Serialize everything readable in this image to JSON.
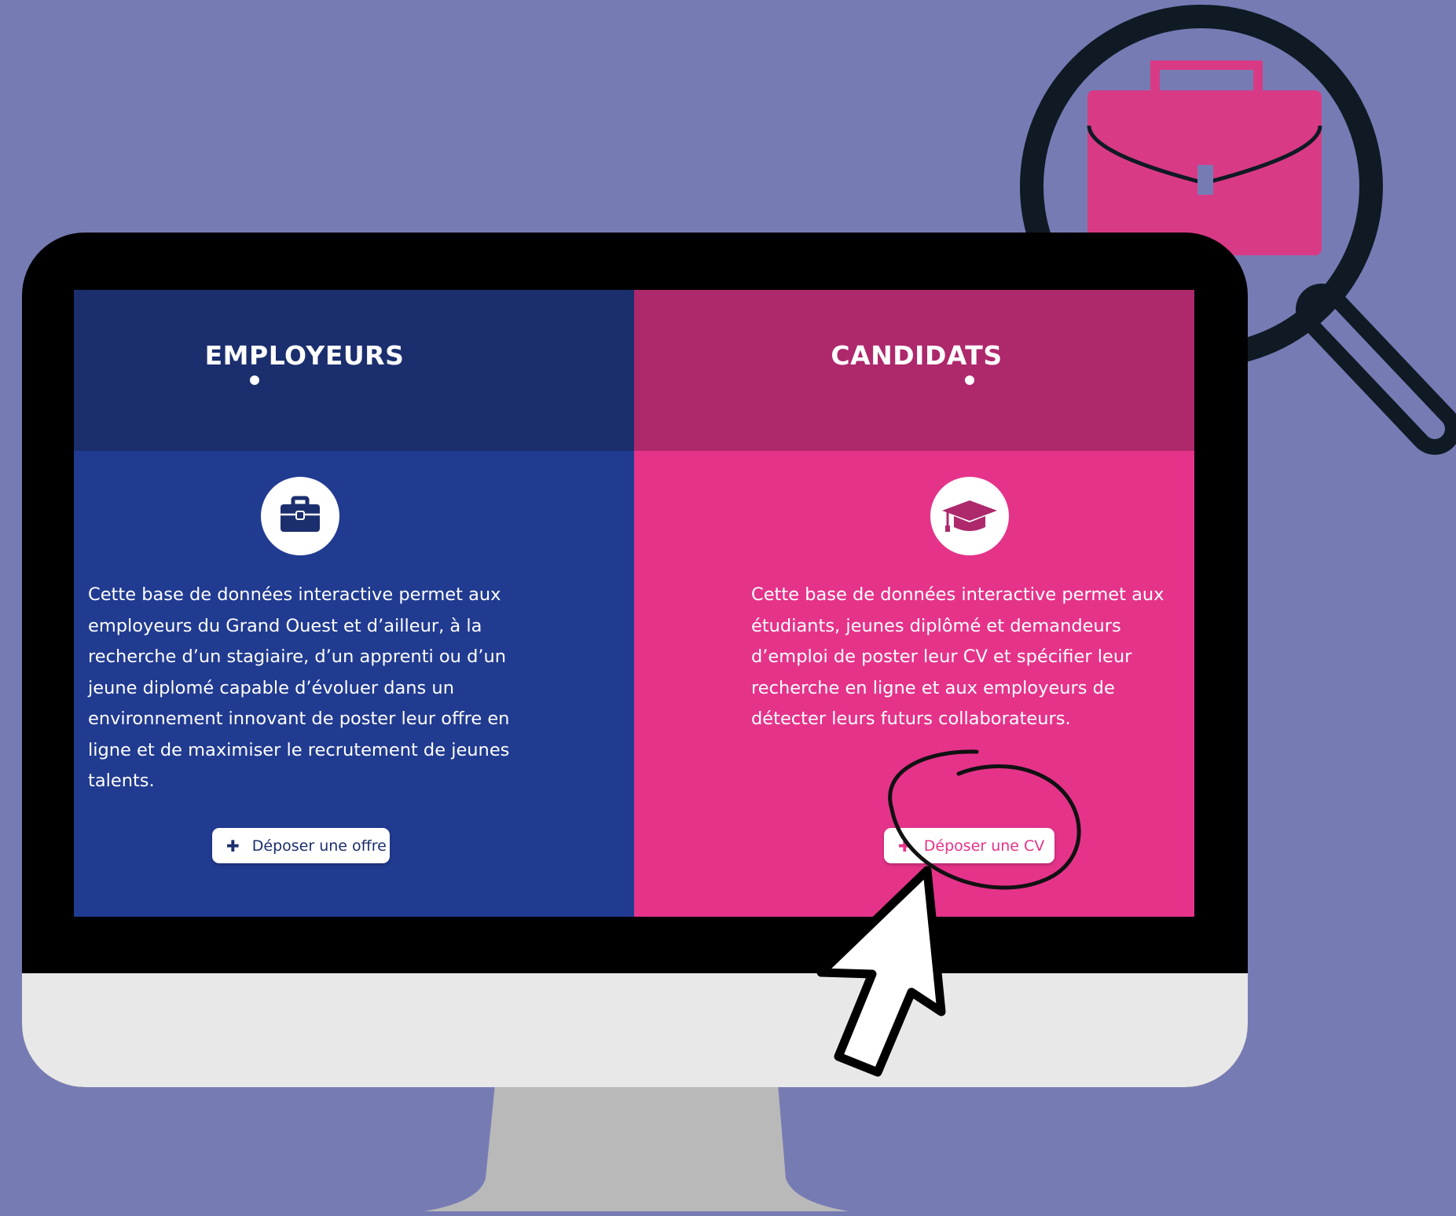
{
  "colors": {
    "background": "#777bb4",
    "employers_header": "#1b2e6d",
    "employers_body": "#213b91",
    "candidates_header": "#ae286c",
    "candidates_body": "#e5338a",
    "magnifier_ring": "#0f1a24",
    "briefcase_pink": "#d93a86"
  },
  "employers": {
    "title": "EMPLOYEURS",
    "icon": "briefcase-icon",
    "description": "Cette base de données interactive permet aux employeurs du Grand Ouest et d’ailleur, à la recherche d’un stagiaire, d’un apprenti ou d’un jeune diplomé capable d’évoluer dans un environnement innovant de poster leur offre en ligne et de maximiser le recrutement de jeunes talents.",
    "button": {
      "icon": "plus-icon",
      "label": "Déposer une offre"
    }
  },
  "candidates": {
    "title": "CANDIDATS",
    "icon": "graduation-cap-icon",
    "description": "Cette base de données interactive permet aux étudiants, jeunes diplômé et demandeurs d’emploi de poster leur CV et spécifier leur recherche en ligne et aux employeurs de détecter leurs futurs collaborateurs.",
    "button": {
      "icon": "plus-icon",
      "label": "Déposer une CV"
    }
  }
}
